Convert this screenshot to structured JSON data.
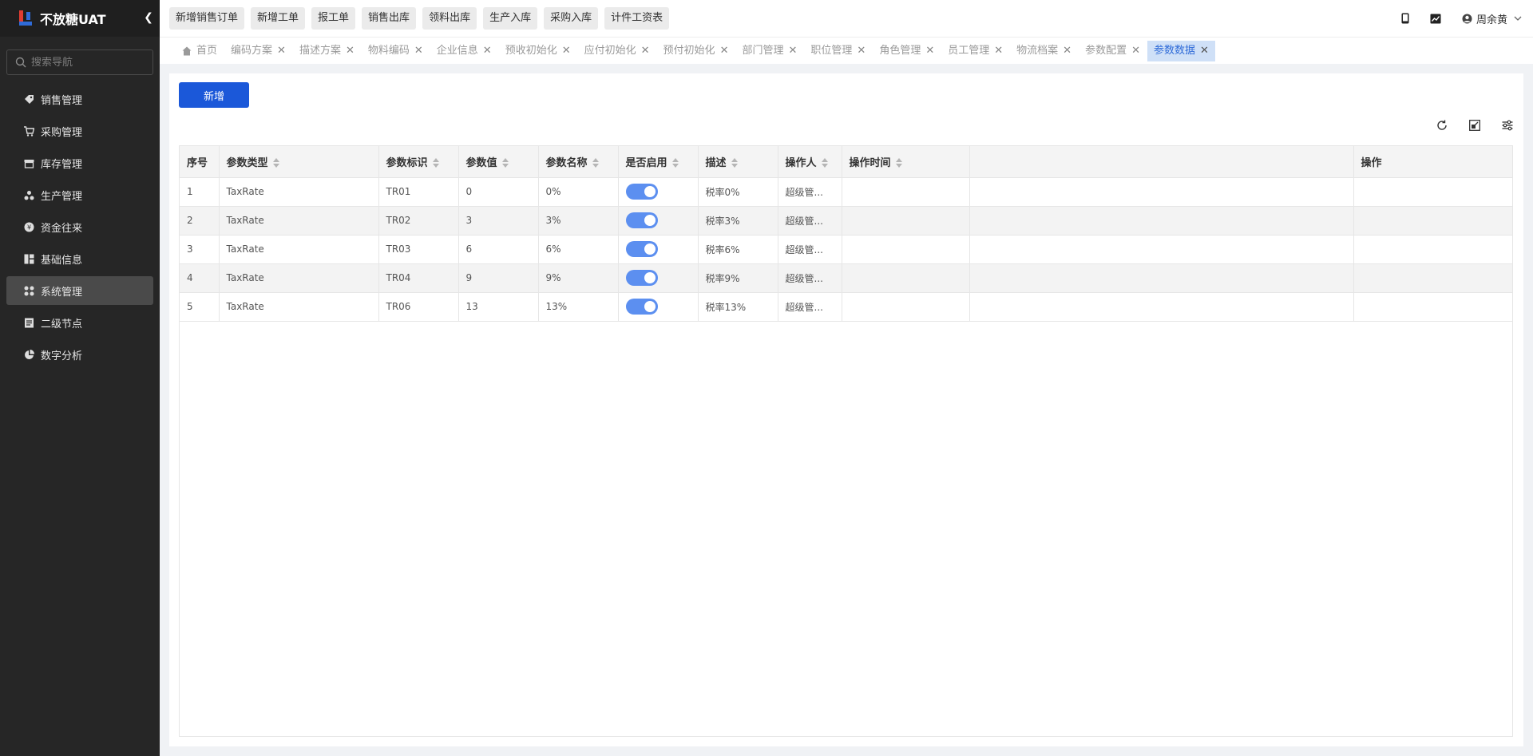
{
  "app": {
    "title": "不放糖UAT"
  },
  "sidebar": {
    "search_placeholder": "搜索导航",
    "items": [
      {
        "label": "销售管理",
        "icon": "tag-icon"
      },
      {
        "label": "采购管理",
        "icon": "cart-icon"
      },
      {
        "label": "库存管理",
        "icon": "inventory-icon"
      },
      {
        "label": "生产管理",
        "icon": "production-icon"
      },
      {
        "label": "资金往来",
        "icon": "money-icon"
      },
      {
        "label": "基础信息",
        "icon": "info-icon"
      },
      {
        "label": "系统管理",
        "icon": "grid-icon",
        "active": true
      },
      {
        "label": "二级节点",
        "icon": "document-icon"
      },
      {
        "label": "数字分析",
        "icon": "pie-icon"
      }
    ]
  },
  "topbar": {
    "quick_buttons": [
      "新增销售订单",
      "新增工单",
      "报工单",
      "销售出库",
      "领料出库",
      "生产入库",
      "采购入库",
      "计件工资表"
    ],
    "user_name": "周余黄"
  },
  "tabs": [
    "首页",
    "编码方案",
    "描述方案",
    "物料编码",
    "企业信息",
    "预收初始化",
    "应付初始化",
    "预付初始化",
    "部门管理",
    "职位管理",
    "角色管理",
    "员工管理",
    "物流档案",
    "参数配置",
    "参数数据"
  ],
  "active_tab": "参数数据",
  "toolbar": {
    "add_label": "新增"
  },
  "table": {
    "headers": [
      "序号",
      "参数类型",
      "参数标识",
      "参数值",
      "参数名称",
      "是否启用",
      "描述",
      "操作人",
      "操作时间",
      "",
      "操作"
    ],
    "rows": [
      {
        "idx": "1",
        "type": "TaxRate",
        "code": "TR01",
        "value": "0",
        "name": "0%",
        "enabled": true,
        "desc": "税率0%",
        "operator": "超级管...",
        "time": ""
      },
      {
        "idx": "2",
        "type": "TaxRate",
        "code": "TR02",
        "value": "3",
        "name": "3%",
        "enabled": true,
        "desc": "税率3%",
        "operator": "超级管...",
        "time": ""
      },
      {
        "idx": "3",
        "type": "TaxRate",
        "code": "TR03",
        "value": "6",
        "name": "6%",
        "enabled": true,
        "desc": "税率6%",
        "operator": "超级管...",
        "time": ""
      },
      {
        "idx": "4",
        "type": "TaxRate",
        "code": "TR04",
        "value": "9",
        "name": "9%",
        "enabled": true,
        "desc": "税率9%",
        "operator": "超级管...",
        "time": ""
      },
      {
        "idx": "5",
        "type": "TaxRate",
        "code": "TR06",
        "value": "13",
        "name": "13%",
        "enabled": true,
        "desc": "税率13%",
        "operator": "超级管...",
        "time": ""
      }
    ]
  },
  "colors": {
    "sidebar_bg": "#262626",
    "primary": "#1b58d9",
    "switch_on": "#5c8ff0",
    "active_tab_bg": "#cfe0f7"
  }
}
